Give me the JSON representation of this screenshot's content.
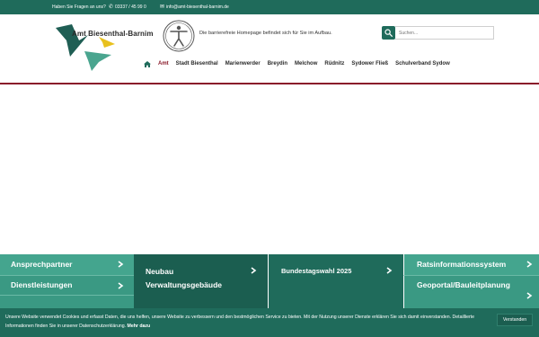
{
  "topbar": {
    "question_text": "Haben Sie Fragen an uns?",
    "phone": "03337 / 45 99 0",
    "email": "info@amt-biesenthal-barnim.de"
  },
  "header": {
    "logo_text": "Amt Biesenthal-Barnim",
    "accessibility_text": "Die barrierefreie Homepage befindet sich für Sie im Aufbau.",
    "search_placeholder": "Suchen..."
  },
  "nav": {
    "items": [
      {
        "label": "Amt"
      },
      {
        "label": "Stadt Biesenthal"
      },
      {
        "label": "Marienwerder"
      },
      {
        "label": "Breydin"
      },
      {
        "label": "Melchow"
      },
      {
        "label": "Rüdnitz"
      },
      {
        "label": "Sydower Fließ"
      },
      {
        "label": "Schulverband Sydow"
      }
    ]
  },
  "tiles": {
    "ansprechpartner": "Ansprechpartner",
    "dienstleistungen": "Dienstleistungen",
    "neubau_line1": "Neubau",
    "neubau_line2": "Verwaltungsgebäude",
    "bundestagswahl": "Bundestagswahl 2025",
    "ratsinfo": "Ratsinformationssystem",
    "geoportal": "Geoportal/Bauleitplanung"
  },
  "cookie": {
    "text_part1": "Unsere Website verwendet Cookies und erfasst Daten, die uns helfen, unsere Website zu verbessern und den bestmöglichen Service zu bieten. Mit der Nutzung unserer Dienste erklären Sie sich damit einverstanden. Detaillierte Informationen finden Sie in unserer Datenschutzerklärung.",
    "more_link": "Mehr dazu",
    "accept_button": "Verstanden"
  },
  "colors": {
    "primary": "#1f6b5b",
    "tile_light": "#44a58e",
    "tile_dark": "#1b5e50",
    "accent_red": "#8a1a2a",
    "logo_yellow": "#e8c11e"
  }
}
